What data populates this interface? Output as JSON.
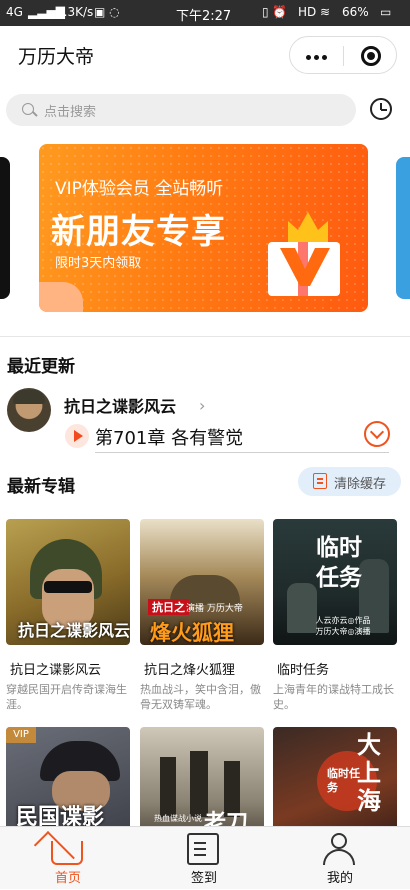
{
  "status_bar": {
    "network": "4G",
    "speed": "0.3K/s",
    "time": "下午2:27",
    "hd": "HD",
    "battery": "66%"
  },
  "header": {
    "title": "万历大帝",
    "more_icon": "more-dots-icon",
    "close_icon": "target-icon"
  },
  "search": {
    "placeholder": "点击搜索",
    "history_icon": "clock-icon"
  },
  "banner": {
    "line1": "VIP体验会员 全站畅听",
    "line2": "新朋友专享",
    "line3": "限时3天内领取",
    "accent": "#ff7a12"
  },
  "recent": {
    "section_title": "最近更新",
    "album_name": "抗日之谍影风云",
    "chevron": "›",
    "chapter": "第701章 各有警觉"
  },
  "albums": {
    "section_title": "最新专辑",
    "clear_label": "清除缓存",
    "items": [
      {
        "title": "抗日之谍影风云",
        "desc": "穿越民国开启传奇谍海生涯。",
        "cover_text": "抗日之谍影风云"
      },
      {
        "title": "抗日之烽火狐狸",
        "desc": "热血战斗，笑中含泪，傲骨无双铸军魂。",
        "cover_top": "抗日之",
        "cover_text": "烽火狐狸",
        "cover_small": "演播 万历大帝"
      },
      {
        "title": "临时任务",
        "desc": "上海青年的谍战特工成长史。",
        "cover_text": "临时任务",
        "cover_small": "人云亦云◎作品 万历大帝◎演播"
      },
      {
        "vip": "VIP",
        "cover_text": "民国谍影"
      },
      {
        "cover_text": "老刀",
        "cover_small": "热血谍战小说"
      },
      {
        "cover_text": "大上海",
        "cover_small": "临时任务"
      }
    ]
  },
  "tabbar": [
    {
      "label": "首页",
      "icon": "home-icon",
      "active": true
    },
    {
      "label": "签到",
      "icon": "checkin-icon",
      "active": false
    },
    {
      "label": "我的",
      "icon": "user-icon",
      "active": false
    }
  ],
  "colors": {
    "accent": "#f0541e",
    "status_bg": "#2e2e2e"
  }
}
